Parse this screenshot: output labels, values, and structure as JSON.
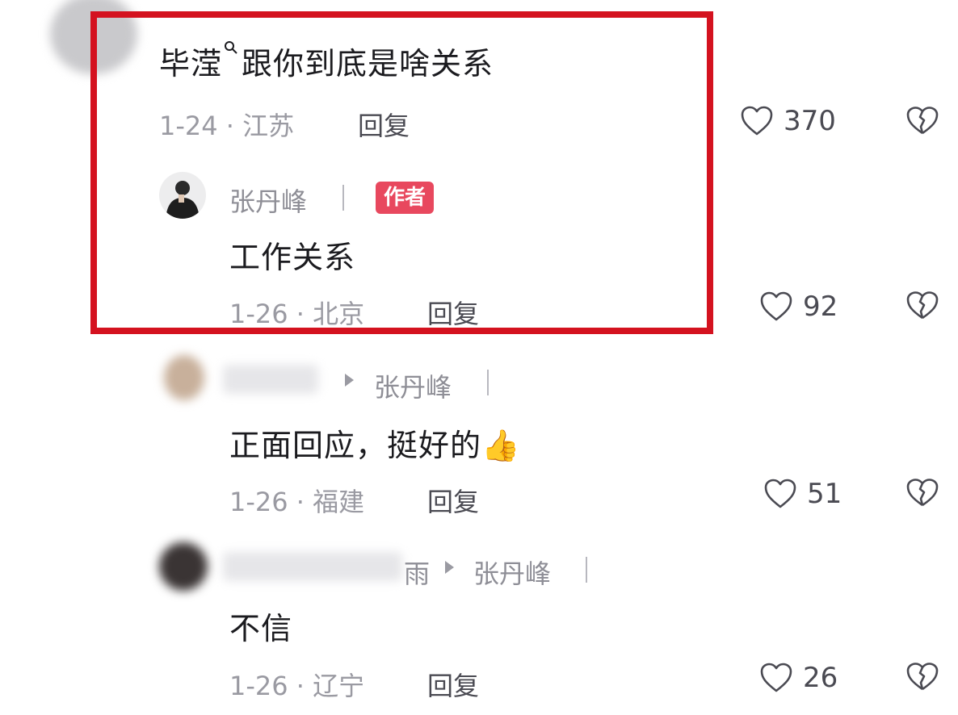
{
  "comments": [
    {
      "text": "毕滢",
      "text_rest": "跟你到底是啥关系",
      "date_location": "1-24 · 江苏",
      "reply_label": "回复",
      "likes": "370"
    },
    {
      "author_name": "张丹峰",
      "author_badge": "作者",
      "text": "工作关系",
      "date_location": "1-26 · 北京",
      "reply_label": "回复",
      "likes": "92"
    },
    {
      "reply_to": "张丹峰",
      "text": "正面回应，挺好的",
      "emoji": "👍",
      "date_location": "1-26 · 福建",
      "reply_label": "回复",
      "likes": "51"
    },
    {
      "username_partial": "雨",
      "reply_to": "张丹峰",
      "text": "不信",
      "date_location": "1-26 · 辽宁",
      "reply_label": "回复",
      "likes": "26"
    }
  ],
  "icons": {
    "like": "heart-outline-icon",
    "dislike": "broken-heart-icon",
    "search": "search-icon",
    "reply_arrow": "triangle-right-icon"
  },
  "colors": {
    "highlight_box": "#d4121f",
    "author_badge": "#e8485e",
    "meta_text": "#9a9aa2"
  }
}
